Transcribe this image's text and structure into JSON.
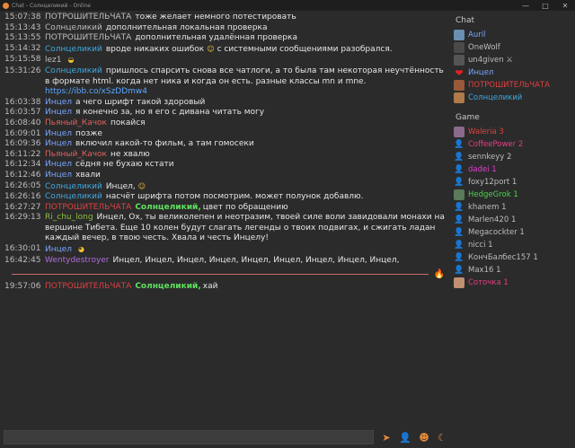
{
  "window": {
    "title": "Chat - Солнцеликий - Online",
    "minimize": "—",
    "maximize": "□",
    "close": "✕"
  },
  "messages": [
    {
      "time": "15:07:38",
      "author": "ПОТРОШИТЕЛЬЧАТА",
      "color": "#bdbdbd",
      "text": "тоже желает немного потестировать"
    },
    {
      "time": "15:13:43",
      "author": "Солнцеликий",
      "color": "#bdbdbd",
      "text": "дополнительная локальная проверка"
    },
    {
      "time": "15:13:55",
      "author": "ПОТРОШИТЕЛЬЧАТА",
      "color": "#bdbdbd",
      "text": "дополнительная удалённая проверка"
    },
    {
      "time": "15:14:32",
      "author": "Солнцеликий",
      "color": "#3fa9e0",
      "text": "вроде никаких ошибок",
      "emoji": "☺",
      "text2": "с системными сообщениями разобрался."
    },
    {
      "time": "15:15:58",
      "author": "lez1",
      "color": "#bdbdbd",
      "text": "",
      "emoji": "◒"
    },
    {
      "time": "15:31:26",
      "author": "Солнцеликий",
      "color": "#3fa9e0",
      "text": "пришлось спарсить снова все чатлоги, а то была там некоторая неучтённость в формате html. когда нет ника и когда он есть. разные классы mn и mne.",
      "link": "https://ibb.co/xSzDDmw4"
    },
    {
      "time": "16:03:38",
      "author": "Инцел",
      "color": "#7aa5ff",
      "text": "а чего шрифт такой здоровый"
    },
    {
      "time": "16:03:57",
      "author": "Инцел",
      "color": "#7aa5ff",
      "text": "я конечно за, но я его с дивана читать могу"
    },
    {
      "time": "16:08:40",
      "author": "Пьяный_Качок",
      "color": "#e06060",
      "text": "покайся"
    },
    {
      "time": "16:09:01",
      "author": "Инцел",
      "color": "#7aa5ff",
      "text": "позже"
    },
    {
      "time": "16:09:36",
      "author": "Инцел",
      "color": "#7aa5ff",
      "text": "включил какой-то фильм, а там гомосеки"
    },
    {
      "time": "16:11:22",
      "author": "Пьяный_Качок",
      "color": "#e06060",
      "text": "не хвалю"
    },
    {
      "time": "16:12:34",
      "author": "Инцел",
      "color": "#7aa5ff",
      "text": "сёдня не бухаю кстати"
    },
    {
      "time": "16:12:46",
      "author": "Инцел",
      "color": "#7aa5ff",
      "text": "хвали"
    },
    {
      "time": "16:26:05",
      "author": "Солнцеликий",
      "color": "#3fa9e0",
      "text": "Инцел,",
      "emoji": "☺"
    },
    {
      "time": "16:26:16",
      "author": "Солнцеликий",
      "color": "#3fa9e0",
      "text": "насчёт шрифта потом посмотрим. может полунок добавлю."
    },
    {
      "time": "16:27:27",
      "author": "ПОТРОШИТЕЛЬЧАТА",
      "color": "#e04040",
      "mention": "Солнцеликий,",
      "text": "цвет по обращению"
    },
    {
      "time": "16:29:13",
      "author": "Ri_chu_long",
      "color": "#8fbf3f",
      "text": "Инцел, Ох, ты великолепен и неотразим, твоей силе воли завидовали монахи на вершине Тибета. Еще 10 колен будут слагать легенды о твоих подвигах, и сжигать ладан каждый вечер, в твою честь. Хвала и честь Инцелу!"
    },
    {
      "time": "16:30:01",
      "author": "Инцел",
      "color": "#7aa5ff",
      "text": "",
      "emoji": "◕"
    },
    {
      "time": "16:42:45",
      "author": "Wentydestroyer",
      "color": "#b06be0",
      "text": "Инцел, Инцел, Инцел, Инцел, Инцел, Инцел, Инцел, Инцел, Инцел,"
    }
  ],
  "divider": {
    "icon": "🔥"
  },
  "after_messages": [
    {
      "time": "19:57:06",
      "author": "ПОТРОШИТЕЛЬЧАТА",
      "color": "#e04040",
      "mention": "Солнцеликий,",
      "text": "хай"
    }
  ],
  "sidebar": {
    "chat_header": "Chat",
    "chat_users": [
      {
        "name": "Auril",
        "color": "#7aa5ff",
        "avatar": "pic",
        "bg": "#6a8fb0"
      },
      {
        "name": "OneWolf",
        "color": "#bdbdbd",
        "avatar": "pic",
        "bg": "#4a4a4a"
      },
      {
        "name": "un4given ⚔",
        "color": "#bdbdbd",
        "avatar": "pic",
        "bg": "#555"
      },
      {
        "name": "Инцел",
        "color": "#7aa5ff",
        "avatar": "heart",
        "bg": "#e02020"
      },
      {
        "name": "ПОТРОШИТЕЛЬЧАТА",
        "color": "#e04040",
        "avatar": "pic",
        "bg": "#9a5a3a"
      },
      {
        "name": "Солнцеликий",
        "color": "#3fa9e0",
        "avatar": "pic",
        "bg": "#b07a4a"
      }
    ],
    "game_header": "Game",
    "game_users": [
      {
        "name": "Waleria 3",
        "color": "#e04040",
        "avatar": "pic",
        "bg": "#8a6a8a"
      },
      {
        "name": "CoffeePower 2",
        "color": "#e04080",
        "avatar": "person"
      },
      {
        "name": "sennkeyy 2",
        "color": "#bdbdbd",
        "avatar": "person"
      },
      {
        "name": "dadei 1",
        "color": "#e040d0",
        "avatar": "person"
      },
      {
        "name": "foxy12port 1",
        "color": "#bdbdbd",
        "avatar": "person"
      },
      {
        "name": "HedgeGrok 1",
        "color": "#4fd04f",
        "avatar": "pic",
        "bg": "#5a7a5a"
      },
      {
        "name": "khanem 1",
        "color": "#bdbdbd",
        "avatar": "person"
      },
      {
        "name": "Marlen420 1",
        "color": "#bdbdbd",
        "avatar": "person"
      },
      {
        "name": "Megacockter 1",
        "color": "#bdbdbd",
        "avatar": "person"
      },
      {
        "name": "nicci 1",
        "color": "#bdbdbd",
        "avatar": "person"
      },
      {
        "name": "КончБалбес157 1",
        "color": "#bdbdbd",
        "avatar": "person"
      },
      {
        "name": "Max16 1",
        "color": "#bdbdbd",
        "avatar": "person"
      },
      {
        "name": "Соточка 1",
        "color": "#e04080",
        "avatar": "pic",
        "bg": "#c09070"
      }
    ]
  },
  "input": {
    "value": "",
    "placeholder": ""
  },
  "buttons": {
    "send": "➤",
    "user": "👤",
    "emoji": "☻",
    "theme": "☾"
  },
  "colors": {
    "accent": "#e8883a",
    "background": "#2b2b2b",
    "divider": "#c86a6a"
  }
}
